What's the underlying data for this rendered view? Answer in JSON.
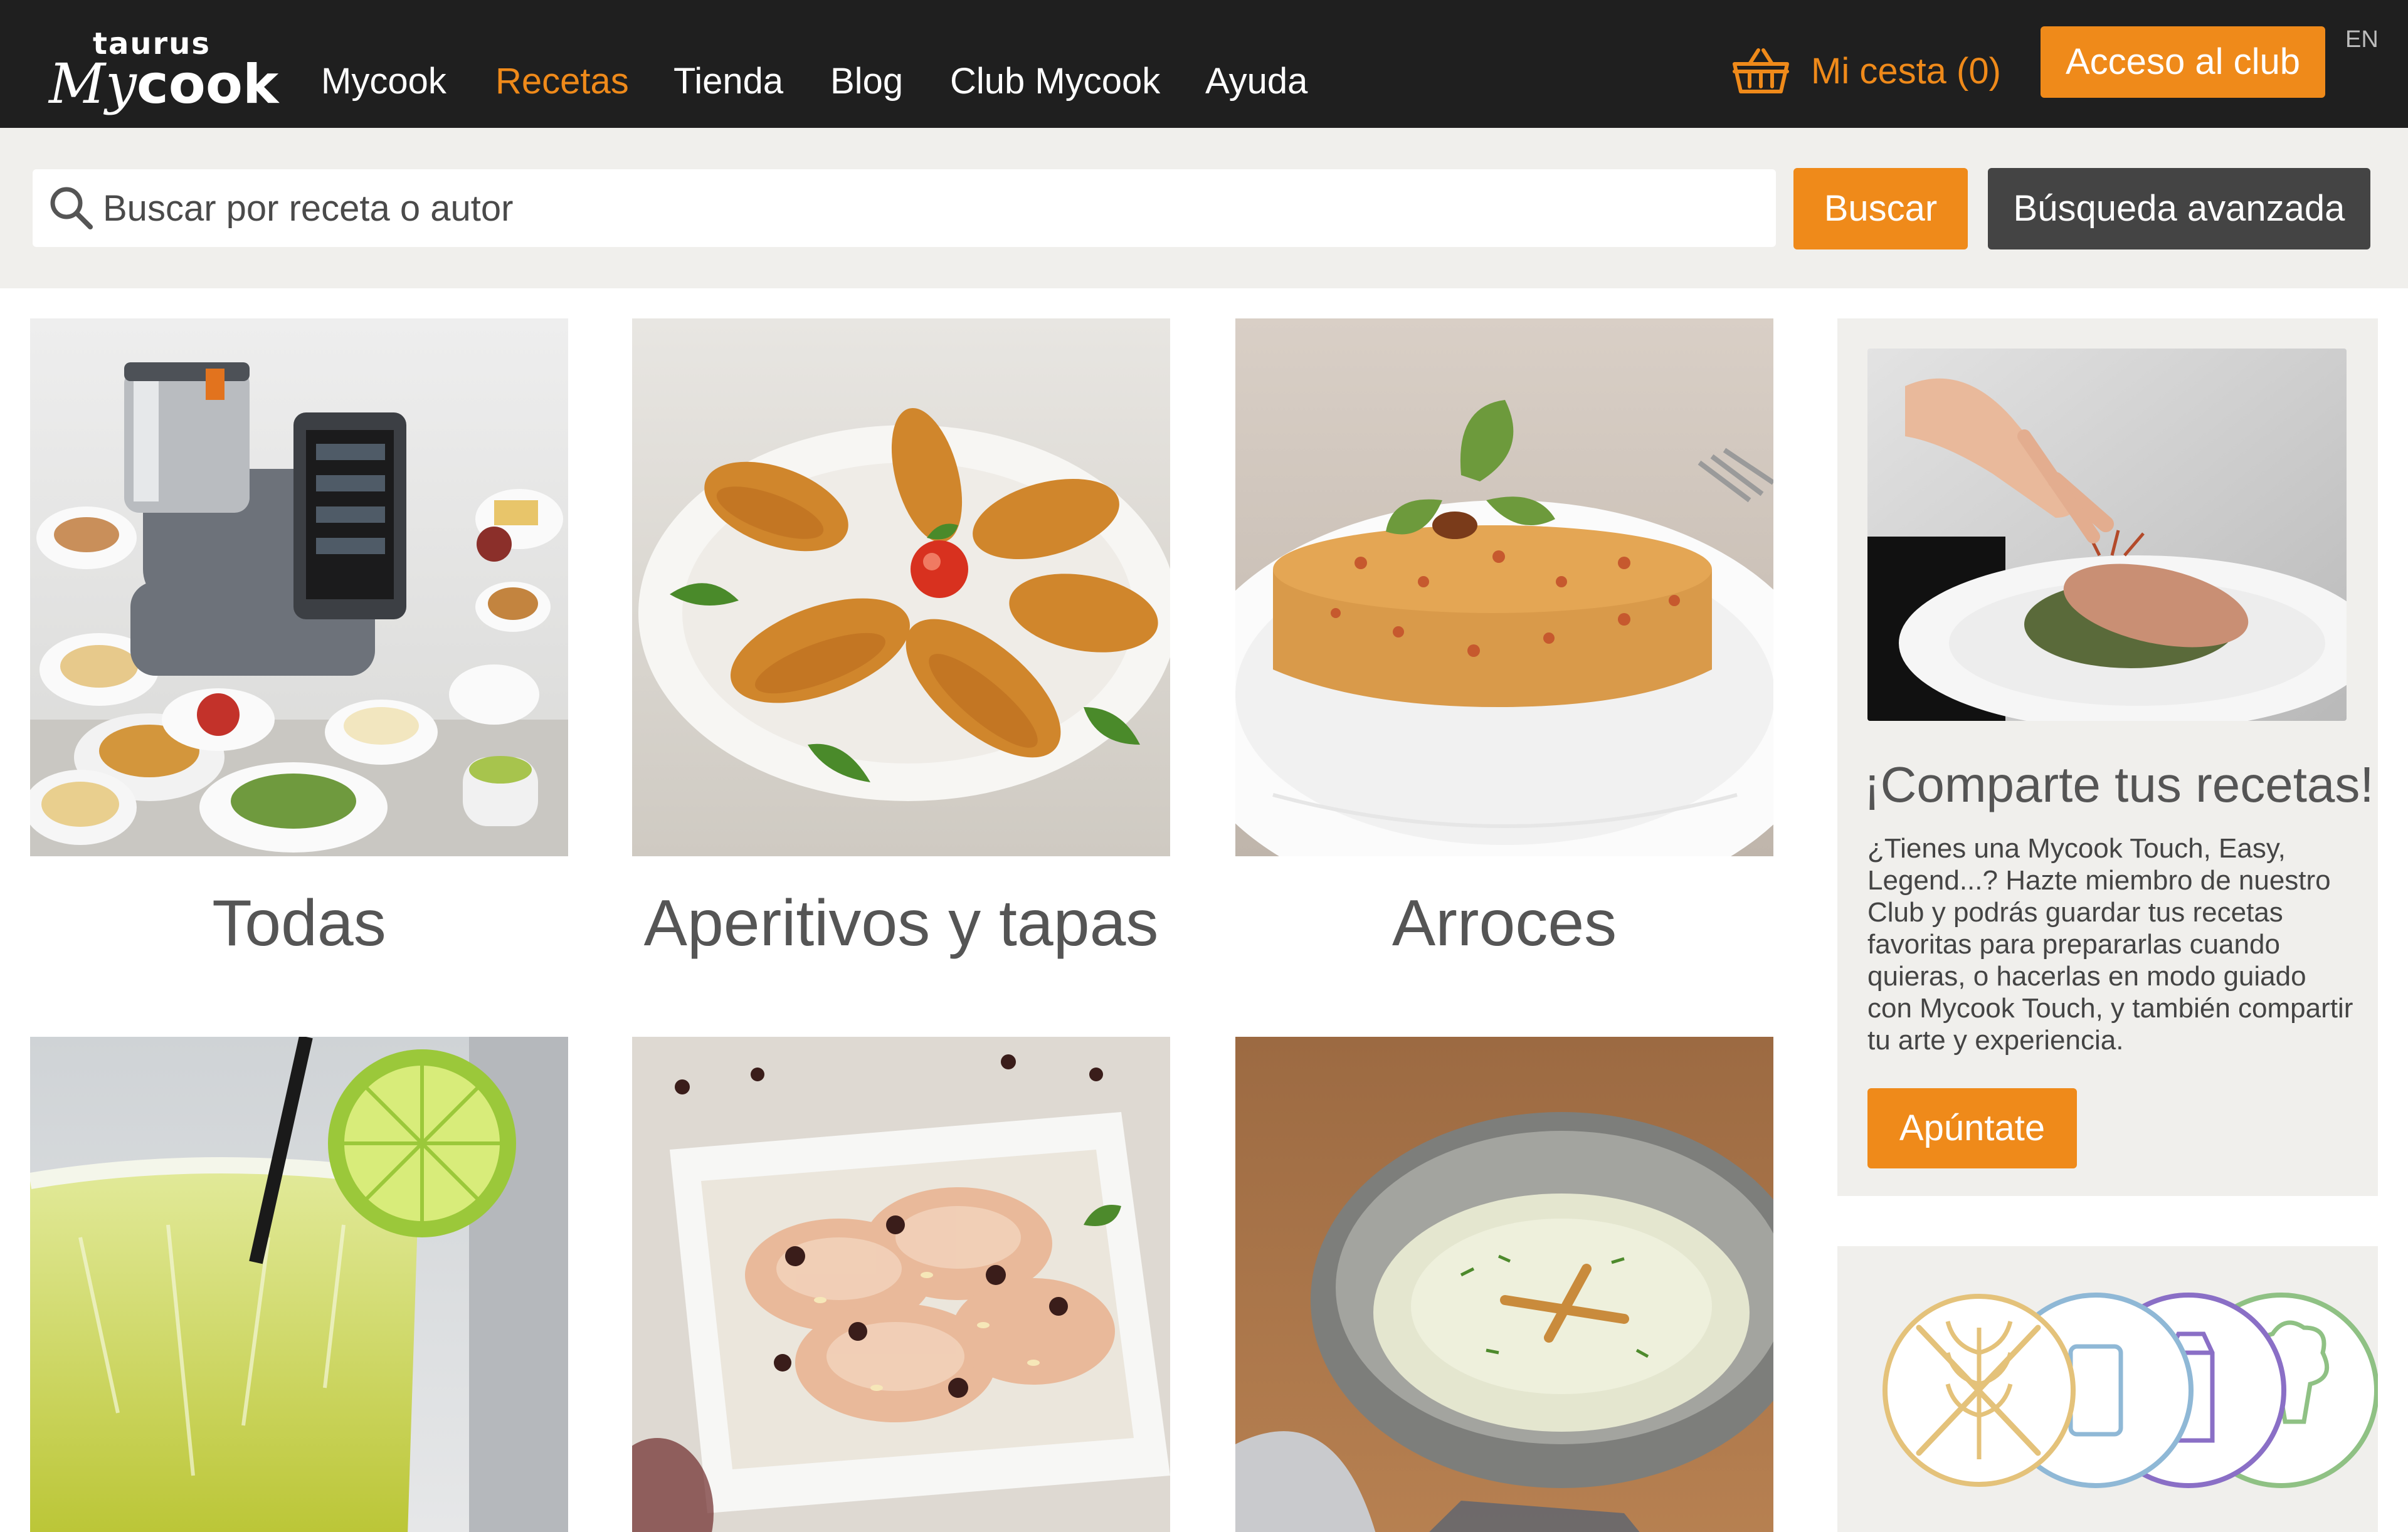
{
  "brand": {
    "maker": "taurus",
    "product_my": "My",
    "product_cook": "cook"
  },
  "nav": {
    "items": [
      "Mycook",
      "Recetas",
      "Tienda",
      "Blog",
      "Club Mycook",
      "Ayuda"
    ],
    "active": "Recetas"
  },
  "cart": {
    "icon": "basket-icon",
    "label": "Mi cesta (0)"
  },
  "club_button": "Acceso al club",
  "language": "EN",
  "search": {
    "icon": "search-icon",
    "placeholder": "Buscar por receta o autor",
    "value": "",
    "submit_label": "Buscar",
    "advanced_label": "Búsqueda avanzada"
  },
  "categories": [
    {
      "label": "Todas",
      "image": "mycook-machine-with-dishes"
    },
    {
      "label": "Aperitivos y tapas",
      "image": "croquettes-plate"
    },
    {
      "label": "Arroces",
      "image": "rice-timbale"
    },
    {
      "label": "",
      "image": "lime-cocktail"
    },
    {
      "label": "",
      "image": "sliced-chicken-with-raisins"
    },
    {
      "label": "",
      "image": "cream-soup-bowl"
    }
  ],
  "promo": {
    "image": "chef-plating-dish",
    "title": "¡Comparte tus recetas!",
    "text": "¿Tienes una Mycook Touch, Easy, Legend...? Hazte miembro de nuestro Club y podrás guardar tus recetas favoritas para prepararlas cuando quieras, o hacerlas en modo guiado con Mycook Touch, y también compartir tu arte y experiencia.",
    "button_label": "Apúntate"
  },
  "diet_icons": [
    "gluten-free-icon",
    "phone-icon",
    "milk-carton-icon",
    "broccoli-icon"
  ],
  "colors": {
    "accent": "#ef8a1a",
    "header_bg": "#1f1f1f",
    "band_bg": "#f0efec",
    "dark_button": "#444444"
  }
}
